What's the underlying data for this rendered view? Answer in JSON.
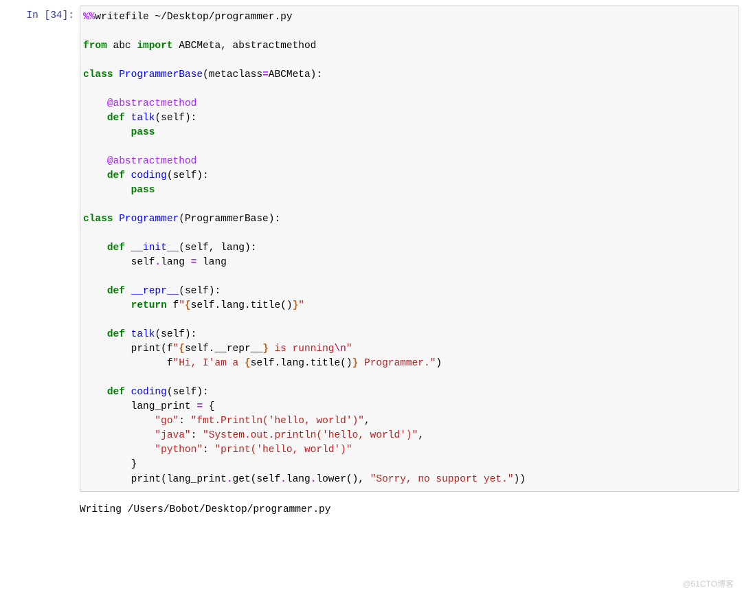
{
  "prompt": {
    "label": "In ",
    "number": "34",
    "open": "[",
    "close": "]:"
  },
  "code": {
    "magic": "%%",
    "writefile": "writefile",
    "path": " ~/Desktop/programmer.py",
    "from": "from",
    "abc_mod": " abc ",
    "import": "import",
    "imports": " ABCMeta, abstractmethod",
    "class_kw": "class",
    "programmerbase": " ProgrammerBase",
    "metaclass_open": "(metaclass",
    "eq": "=",
    "abcmeta_close": "ABCMeta):",
    "dec_abstractmethod": "@abstractmethod",
    "def_kw": "def",
    "talk_name": " talk",
    "self_paren": "(self):",
    "pass_kw": "pass",
    "coding_name": " coding",
    "programmer_name": " Programmer",
    "programmer_paren": "(ProgrammerBase):",
    "init_name": " __init__",
    "init_params": "(self, lang):",
    "self_lang": "        self",
    "dot_lang": ".lang ",
    "assign_lang": " lang",
    "repr_name": " __repr__",
    "return_kw": "return",
    "f_prefix": " f",
    "repr_str_open": "\"",
    "repr_interp_open": "{",
    "repr_interp_body": "self.lang.title()",
    "repr_interp_close": "}",
    "repr_str_close": "\"",
    "talk_print": "        print(f",
    "talk_str1_open": "\"",
    "talk_interp1_open": "{",
    "talk_interp1_body": "self.__repr__",
    "talk_interp1_close": "}",
    "talk_str1_mid": " is running",
    "talk_str1_esc": "\\n",
    "talk_str1_close": "\"",
    "talk_line2_indent": "              f",
    "talk_str2_open": "\"Hi, I'am a ",
    "talk_interp2_open": "{",
    "talk_interp2_body": "self.lang.title()",
    "talk_interp2_close": "}",
    "talk_str2_close": " Programmer.\"",
    "talk_paren_close": ")",
    "coding_lp": "        lang_print ",
    "coding_lp_open": " {",
    "dict_go_key": "\"go\"",
    "dict_go_val": "\"fmt.Println('hello, world')\"",
    "dict_java_key": "\"java\"",
    "dict_java_val": "\"System.out.println('hello, world')\"",
    "dict_python_key": "\"python\"",
    "dict_python_val": "\"print('hello, world')\"",
    "dict_close": "        }",
    "colon_sp": ": ",
    "comma": ",",
    "dict_indent": "            ",
    "coding_print": "        print(lang_print",
    "coding_print_get": ".get(self",
    "coding_print_lower": ".lang",
    "coding_print_lower2": ".lower(), ",
    "sorry_str": "\"Sorry, no support yet.\"",
    "coding_print_close": "))"
  },
  "output": {
    "text": "Writing /Users/Bobot/Desktop/programmer.py"
  },
  "watermark": "@51CTO博客"
}
